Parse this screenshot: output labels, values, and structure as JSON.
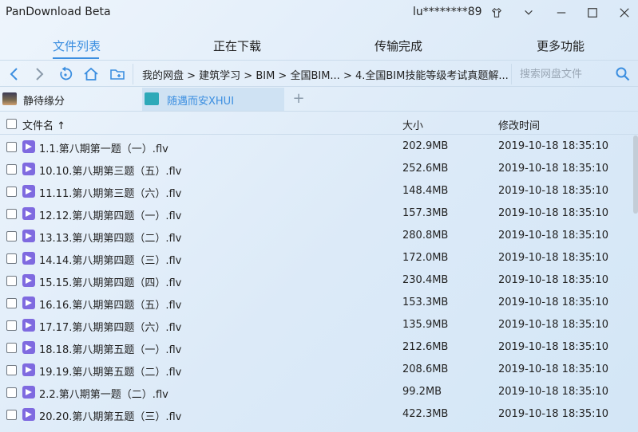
{
  "app": {
    "title": "PanDownload Beta",
    "username": "lu********89"
  },
  "tabs": [
    {
      "label": "文件列表",
      "active": true
    },
    {
      "label": "正在下载",
      "active": false
    },
    {
      "label": "传输完成",
      "active": false
    },
    {
      "label": "更多功能",
      "active": false
    }
  ],
  "toolbar": {
    "breadcrumb": "我的网盘 > 建筑学习 > BIM > 全国BIM... > 4.全国BIM技能等级考试真题解...",
    "search_placeholder": "搜索网盘文件"
  },
  "accounts": [
    {
      "label": "静待缘分",
      "active": false
    },
    {
      "label": "随遇而安XHUI",
      "active": true
    }
  ],
  "account_add_label": "+",
  "list": {
    "header": {
      "name": "文件名 ↑",
      "size": "大小",
      "time": "修改时间"
    },
    "rows": [
      {
        "name": "1.1.第八期第一题（一）.flv",
        "size": "202.9MB",
        "time": "2019-10-18 18:35:10"
      },
      {
        "name": "10.10.第八期第三题（五）.flv",
        "size": "252.6MB",
        "time": "2019-10-18 18:35:10"
      },
      {
        "name": "11.11.第八期第三题（六）.flv",
        "size": "148.4MB",
        "time": "2019-10-18 18:35:10"
      },
      {
        "name": "12.12.第八期第四题（一）.flv",
        "size": "157.3MB",
        "time": "2019-10-18 18:35:10"
      },
      {
        "name": "13.13.第八期第四题（二）.flv",
        "size": "280.8MB",
        "time": "2019-10-18 18:35:10"
      },
      {
        "name": "14.14.第八期第四题（三）.flv",
        "size": "172.0MB",
        "time": "2019-10-18 18:35:10"
      },
      {
        "name": "15.15.第八期第四题（四）.flv",
        "size": "230.4MB",
        "time": "2019-10-18 18:35:10"
      },
      {
        "name": "16.16.第八期第四题（五）.flv",
        "size": "153.3MB",
        "time": "2019-10-18 18:35:10"
      },
      {
        "name": "17.17.第八期第四题（六）.flv",
        "size": "135.9MB",
        "time": "2019-10-18 18:35:10"
      },
      {
        "name": "18.18.第八期第五题（一）.flv",
        "size": "212.6MB",
        "time": "2019-10-18 18:35:10"
      },
      {
        "name": "19.19.第八期第五题（二）.flv",
        "size": "208.6MB",
        "time": "2019-10-18 18:35:10"
      },
      {
        "name": "2.2.第八期第一题（二）.flv",
        "size": "99.2MB",
        "time": "2019-10-18 18:35:10"
      },
      {
        "name": "20.20.第八期第五题（三）.flv",
        "size": "422.3MB",
        "time": "2019-10-18 18:35:10"
      }
    ]
  },
  "colors": {
    "accent": "#3b8ee0",
    "file_icon": "#7f6ae0",
    "background": "#e4f0fa"
  },
  "icons": {
    "window": [
      "skin-icon",
      "chevron-down-icon",
      "minimize-icon",
      "maximize-icon",
      "close-icon"
    ],
    "toolbar": [
      "back-icon",
      "forward-icon",
      "refresh-icon",
      "home-icon",
      "new-folder-icon",
      "search-icon"
    ],
    "file": "video-file-icon"
  }
}
